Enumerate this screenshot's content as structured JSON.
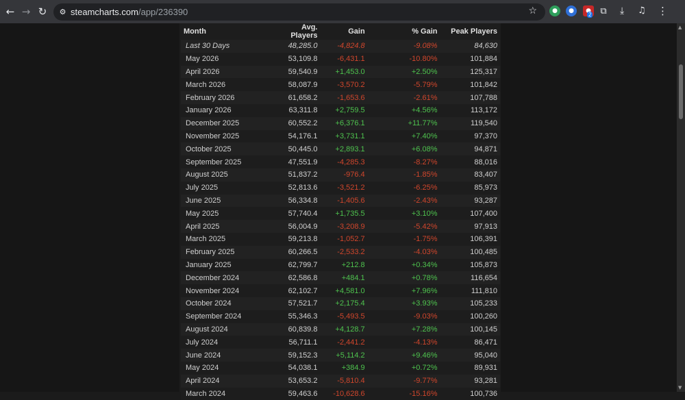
{
  "browser": {
    "url_host": "steamcharts.com",
    "url_path": "/app/236390",
    "ext3_badge": "2"
  },
  "table": {
    "headers": [
      "Month",
      "Avg. Players",
      "Gain",
      "% Gain",
      "Peak Players"
    ],
    "rows": [
      {
        "month": "Last 30 Days",
        "avg": "48,285.0",
        "gain": "-4,824.8",
        "pct": "-9.08%",
        "peak": "84,630",
        "trend": "neg",
        "latest": true
      },
      {
        "month": "May 2026",
        "avg": "53,109.8",
        "gain": "-6,431.1",
        "pct": "-10.80%",
        "peak": "101,884",
        "trend": "neg"
      },
      {
        "month": "April 2026",
        "avg": "59,540.9",
        "gain": "+1,453.0",
        "pct": "+2.50%",
        "peak": "125,317",
        "trend": "pos"
      },
      {
        "month": "March 2026",
        "avg": "58,087.9",
        "gain": "-3,570.2",
        "pct": "-5.79%",
        "peak": "101,842",
        "trend": "neg"
      },
      {
        "month": "February 2026",
        "avg": "61,658.2",
        "gain": "-1,653.6",
        "pct": "-2.61%",
        "peak": "107,788",
        "trend": "neg"
      },
      {
        "month": "January 2026",
        "avg": "63,311.8",
        "gain": "+2,759.5",
        "pct": "+4.56%",
        "peak": "113,172",
        "trend": "pos"
      },
      {
        "month": "December 2025",
        "avg": "60,552.2",
        "gain": "+6,376.1",
        "pct": "+11.77%",
        "peak": "119,540",
        "trend": "pos"
      },
      {
        "month": "November 2025",
        "avg": "54,176.1",
        "gain": "+3,731.1",
        "pct": "+7.40%",
        "peak": "97,370",
        "trend": "pos"
      },
      {
        "month": "October 2025",
        "avg": "50,445.0",
        "gain": "+2,893.1",
        "pct": "+6.08%",
        "peak": "94,871",
        "trend": "pos"
      },
      {
        "month": "September 2025",
        "avg": "47,551.9",
        "gain": "-4,285.3",
        "pct": "-8.27%",
        "peak": "88,016",
        "trend": "neg"
      },
      {
        "month": "August 2025",
        "avg": "51,837.2",
        "gain": "-976.4",
        "pct": "-1.85%",
        "peak": "83,407",
        "trend": "neg"
      },
      {
        "month": "July 2025",
        "avg": "52,813.6",
        "gain": "-3,521.2",
        "pct": "-6.25%",
        "peak": "85,973",
        "trend": "neg"
      },
      {
        "month": "June 2025",
        "avg": "56,334.8",
        "gain": "-1,405.6",
        "pct": "-2.43%",
        "peak": "93,287",
        "trend": "neg"
      },
      {
        "month": "May 2025",
        "avg": "57,740.4",
        "gain": "+1,735.5",
        "pct": "+3.10%",
        "peak": "107,400",
        "trend": "pos"
      },
      {
        "month": "April 2025",
        "avg": "56,004.9",
        "gain": "-3,208.9",
        "pct": "-5.42%",
        "peak": "97,913",
        "trend": "neg"
      },
      {
        "month": "March 2025",
        "avg": "59,213.8",
        "gain": "-1,052.7",
        "pct": "-1.75%",
        "peak": "106,391",
        "trend": "neg"
      },
      {
        "month": "February 2025",
        "avg": "60,266.5",
        "gain": "-2,533.2",
        "pct": "-4.03%",
        "peak": "100,485",
        "trend": "neg"
      },
      {
        "month": "January 2025",
        "avg": "62,799.7",
        "gain": "+212.8",
        "pct": "+0.34%",
        "peak": "105,873",
        "trend": "pos"
      },
      {
        "month": "December 2024",
        "avg": "62,586.8",
        "gain": "+484.1",
        "pct": "+0.78%",
        "peak": "116,654",
        "trend": "pos"
      },
      {
        "month": "November 2024",
        "avg": "62,102.7",
        "gain": "+4,581.0",
        "pct": "+7.96%",
        "peak": "111,810",
        "trend": "pos"
      },
      {
        "month": "October 2024",
        "avg": "57,521.7",
        "gain": "+2,175.4",
        "pct": "+3.93%",
        "peak": "105,233",
        "trend": "pos"
      },
      {
        "month": "September 2024",
        "avg": "55,346.3",
        "gain": "-5,493.5",
        "pct": "-9.03%",
        "peak": "100,260",
        "trend": "neg"
      },
      {
        "month": "August 2024",
        "avg": "60,839.8",
        "gain": "+4,128.7",
        "pct": "+7.28%",
        "peak": "100,145",
        "trend": "pos"
      },
      {
        "month": "July 2024",
        "avg": "56,711.1",
        "gain": "-2,441.2",
        "pct": "-4.13%",
        "peak": "86,471",
        "trend": "neg"
      },
      {
        "month": "June 2024",
        "avg": "59,152.3",
        "gain": "+5,114.2",
        "pct": "+9.46%",
        "peak": "95,040",
        "trend": "pos"
      },
      {
        "month": "May 2024",
        "avg": "54,038.1",
        "gain": "+384.9",
        "pct": "+0.72%",
        "peak": "89,931",
        "trend": "pos"
      },
      {
        "month": "April 2024",
        "avg": "53,653.2",
        "gain": "-5,810.4",
        "pct": "-9.77%",
        "peak": "93,281",
        "trend": "neg"
      },
      {
        "month": "March 2024",
        "avg": "59,463.6",
        "gain": "-10,628.6",
        "pct": "-15.16%",
        "peak": "100,736",
        "trend": "neg"
      }
    ]
  }
}
